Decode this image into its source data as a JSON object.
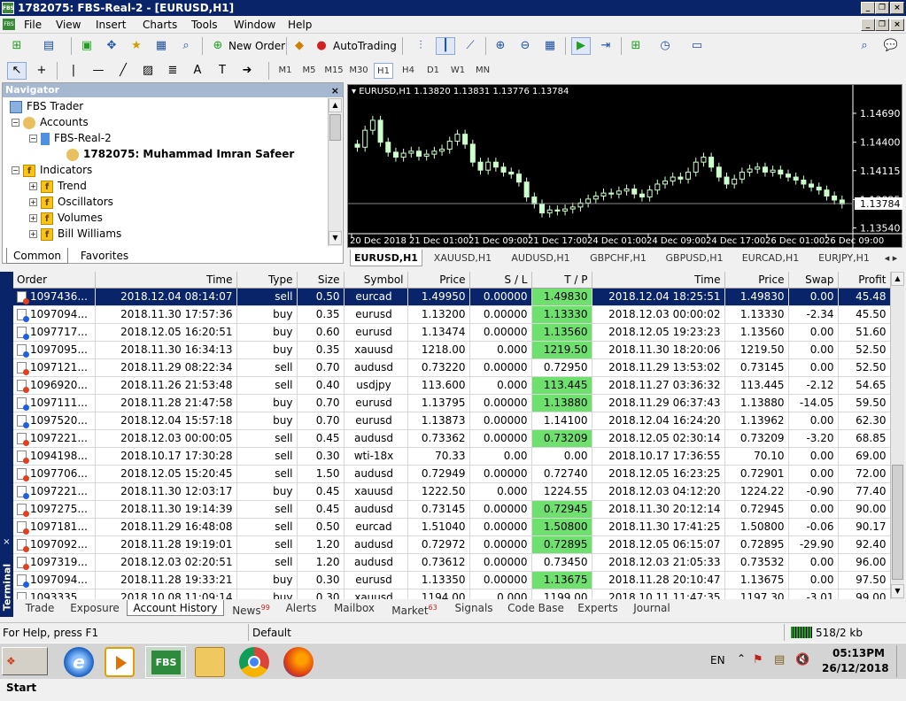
{
  "app": {
    "title": "1782075: FBS-Real-2 - [EURUSD,H1]",
    "logo": "FBS"
  },
  "menu": [
    "File",
    "View",
    "Insert",
    "Charts",
    "Tools",
    "Window",
    "Help"
  ],
  "toolbar": {
    "new_order": "New Order",
    "autotrading": "AutoTrading"
  },
  "timeframes": [
    "M1",
    "M5",
    "M15",
    "M30",
    "H1",
    "H4",
    "D1",
    "W1",
    "MN"
  ],
  "navigator": {
    "title": "Navigator",
    "items": [
      {
        "label": "FBS Trader"
      },
      {
        "label": "Accounts"
      },
      {
        "label": "FBS-Real-2"
      },
      {
        "label": "1782075: Muhammad Imran Safeer"
      },
      {
        "label": "Indicators"
      },
      {
        "label": "Trend"
      },
      {
        "label": "Oscillators"
      },
      {
        "label": "Volumes"
      },
      {
        "label": "Bill Williams"
      }
    ],
    "tabs": [
      "Common",
      "Favorites"
    ]
  },
  "chart": {
    "header": "EURUSD,H1  1.13820 1.13831 1.13776 1.13784",
    "current_price": "1.13784",
    "price_labels": [
      "1.14690",
      "1.14400",
      "1.14115",
      "1.13825",
      "1.13540"
    ],
    "time_labels": [
      "20 Dec 2018",
      "21 Dec 01:00",
      "21 Dec 09:00",
      "21 Dec 17:00",
      "24 Dec 01:00",
      "24 Dec 09:00",
      "24 Dec 17:00",
      "26 Dec 01:00",
      "26 Dec 09:00"
    ],
    "tabs": [
      "EURUSD,H1",
      "XAUUSD,H1",
      "AUDUSD,H1",
      "GBPCHF,H1",
      "GBPUSD,H1",
      "EURCAD,H1",
      "EURJPY,H1"
    ]
  },
  "chart_data": {
    "type": "candlestick",
    "symbol": "EURUSD",
    "timeframe": "H1",
    "last": {
      "open": 1.1382,
      "high": 1.13831,
      "low": 1.13776,
      "close": 1.13784
    },
    "ylim": [
      1.135,
      1.1485
    ],
    "y_ticks": [
      1.1354,
      1.13825,
      1.14115,
      1.144,
      1.1469
    ],
    "close_series": [
      1.1435,
      1.1452,
      1.1462,
      1.144,
      1.143,
      1.1425,
      1.1429,
      1.1431,
      1.1426,
      1.1428,
      1.1431,
      1.1433,
      1.1441,
      1.1448,
      1.1438,
      1.142,
      1.1412,
      1.142,
      1.1415,
      1.141,
      1.1408,
      1.14,
      1.1385,
      1.1378,
      1.1369,
      1.1372,
      1.1371,
      1.1373,
      1.1375,
      1.1379,
      1.1383,
      1.1386,
      1.1389,
      1.1388,
      1.1391,
      1.1393,
      1.1388,
      1.1385,
      1.1392,
      1.1398,
      1.1401,
      1.1405,
      1.1403,
      1.141,
      1.142,
      1.1425,
      1.1415,
      1.1405,
      1.1398,
      1.1403,
      1.141,
      1.1413,
      1.1415,
      1.141,
      1.1412,
      1.1408,
      1.1405,
      1.1402,
      1.1398,
      1.1395,
      1.1392,
      1.1386,
      1.1382,
      1.1378
    ]
  },
  "table": {
    "columns": [
      "Order",
      "Time",
      "Type",
      "Size",
      "Symbol",
      "Price",
      "S / L",
      "T / P",
      "Time",
      "Price",
      "Swap",
      "Profit"
    ],
    "rows": [
      [
        "1097436...",
        "2018.12.04 08:14:07",
        "sell",
        "0.50",
        "eurcad",
        "1.49950",
        "0.00000",
        "1.49830",
        "2018.12.04 18:25:51",
        "1.49830",
        "0.00",
        "45.48"
      ],
      [
        "1097094...",
        "2018.11.30 17:57:36",
        "buy",
        "0.35",
        "eurusd",
        "1.13200",
        "0.00000",
        "1.13330",
        "2018.12.03 00:00:02",
        "1.13330",
        "-2.34",
        "45.50"
      ],
      [
        "1097717...",
        "2018.12.05 16:20:51",
        "buy",
        "0.60",
        "eurusd",
        "1.13474",
        "0.00000",
        "1.13560",
        "2018.12.05 19:23:23",
        "1.13560",
        "0.00",
        "51.60"
      ],
      [
        "1097095...",
        "2018.11.30 16:34:13",
        "buy",
        "0.35",
        "xauusd",
        "1218.00",
        "0.000",
        "1219.50",
        "2018.11.30 18:20:06",
        "1219.50",
        "0.00",
        "52.50"
      ],
      [
        "1097121...",
        "2018.11.29 08:22:34",
        "sell",
        "0.70",
        "audusd",
        "0.73220",
        "0.00000",
        "0.72950",
        "2018.11.29 13:53:02",
        "0.73145",
        "0.00",
        "52.50"
      ],
      [
        "1096920...",
        "2018.11.26 21:53:48",
        "sell",
        "0.40",
        "usdjpy",
        "113.600",
        "0.000",
        "113.445",
        "2018.11.27 03:36:32",
        "113.445",
        "-2.12",
        "54.65"
      ],
      [
        "1097111...",
        "2018.11.28 21:47:58",
        "buy",
        "0.70",
        "eurusd",
        "1.13795",
        "0.00000",
        "1.13880",
        "2018.11.29 06:37:43",
        "1.13880",
        "-14.05",
        "59.50"
      ],
      [
        "1097520...",
        "2018.12.04 15:57:18",
        "buy",
        "0.70",
        "eurusd",
        "1.13873",
        "0.00000",
        "1.14100",
        "2018.12.04 16:24:20",
        "1.13962",
        "0.00",
        "62.30"
      ],
      [
        "1097221...",
        "2018.12.03 00:00:05",
        "sell",
        "0.45",
        "audusd",
        "0.73362",
        "0.00000",
        "0.73209",
        "2018.12.05 02:30:14",
        "0.73209",
        "-3.20",
        "68.85"
      ],
      [
        "1094198...",
        "2018.10.17 17:30:28",
        "sell",
        "0.30",
        "wti-18x",
        "70.33",
        "0.00",
        "0.00",
        "2018.10.17 17:36:55",
        "70.10",
        "0.00",
        "69.00"
      ],
      [
        "1097706...",
        "2018.12.05 15:20:45",
        "sell",
        "1.50",
        "audusd",
        "0.72949",
        "0.00000",
        "0.72740",
        "2018.12.05 16:23:25",
        "0.72901",
        "0.00",
        "72.00"
      ],
      [
        "1097221...",
        "2018.11.30 12:03:17",
        "buy",
        "0.45",
        "xauusd",
        "1222.50",
        "0.000",
        "1224.55",
        "2018.12.03 04:12:20",
        "1224.22",
        "-0.90",
        "77.40"
      ],
      [
        "1097275...",
        "2018.11.30 19:14:39",
        "sell",
        "0.45",
        "audusd",
        "0.73145",
        "0.00000",
        "0.72945",
        "2018.11.30 20:12:14",
        "0.72945",
        "0.00",
        "90.00"
      ],
      [
        "1097181...",
        "2018.11.29 16:48:08",
        "sell",
        "0.50",
        "eurcad",
        "1.51040",
        "0.00000",
        "1.50800",
        "2018.11.30 17:41:25",
        "1.50800",
        "-0.06",
        "90.17"
      ],
      [
        "1097092...",
        "2018.11.28 19:19:01",
        "sell",
        "1.20",
        "audusd",
        "0.72972",
        "0.00000",
        "0.72895",
        "2018.12.05 06:15:07",
        "0.72895",
        "-29.90",
        "92.40"
      ],
      [
        "1097319...",
        "2018.12.03 02:20:51",
        "sell",
        "1.20",
        "audusd",
        "0.73612",
        "0.00000",
        "0.73450",
        "2018.12.03 21:05:33",
        "0.73532",
        "0.00",
        "96.00"
      ],
      [
        "1097094...",
        "2018.11.28 19:33:21",
        "buy",
        "0.30",
        "eurusd",
        "1.13350",
        "0.00000",
        "1.13675",
        "2018.11.28 20:10:47",
        "1.13675",
        "0.00",
        "97.50"
      ],
      [
        "1093335...",
        "2018.10.08 11:09:14",
        "buy",
        "0.30",
        "xauusd",
        "1194.00",
        "0.000",
        "1199.00",
        "2018.10.11 11:47:35",
        "1197.30",
        "-3.01",
        "99.00"
      ]
    ],
    "tp_highlight": [
      0,
      1,
      2,
      3,
      5,
      6,
      8,
      12,
      13,
      14,
      16
    ]
  },
  "terminal": {
    "label": "Terminal",
    "tabs": [
      {
        "label": "Trade"
      },
      {
        "label": "Exposure"
      },
      {
        "label": "Account History"
      },
      {
        "label": "News",
        "badge": "99"
      },
      {
        "label": "Alerts"
      },
      {
        "label": "Mailbox"
      },
      {
        "label": "Market",
        "badge": "63"
      },
      {
        "label": "Signals"
      },
      {
        "label": "Code Base"
      },
      {
        "label": "Experts"
      },
      {
        "label": "Journal"
      }
    ]
  },
  "status": {
    "help": "For Help, press F1",
    "profile": "Default",
    "traffic": "518/2 kb"
  },
  "taskbar": {
    "start": "Start",
    "fbs": "FBS",
    "lang": "EN",
    "time": "05:13PM",
    "date": "26/12/2018"
  }
}
